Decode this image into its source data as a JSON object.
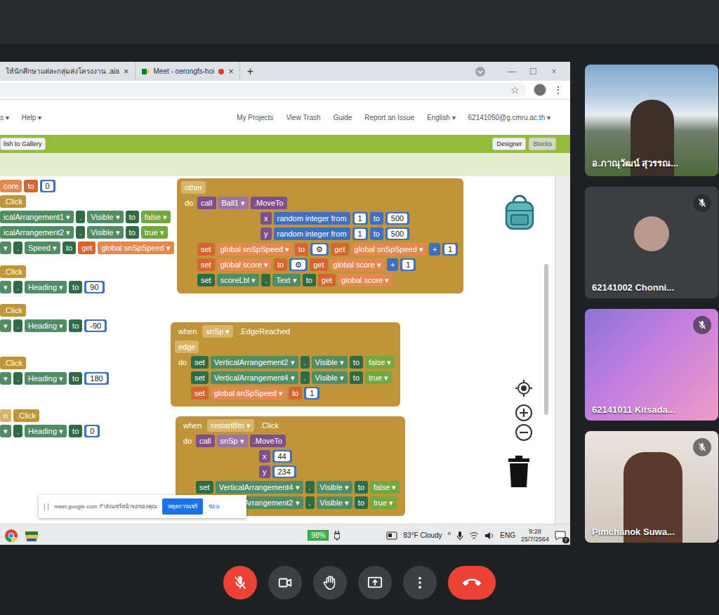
{
  "browser": {
    "tabs": [
      {
        "label": "ให้นักศึกษาแต่ละกลุ่มส่งโครงงาน .aia",
        "selected": false,
        "recording": false
      },
      {
        "label": "Meet - oerongfs-hoi",
        "selected": false,
        "recording": true
      }
    ],
    "tab_close": "×",
    "new_tab": "+",
    "window_controls": [
      "—",
      "☐",
      "×"
    ],
    "toolbar": {
      "star": "☆",
      "menu": "⋮"
    }
  },
  "appinventor": {
    "left_menu": [
      "s ▾",
      "Help ▾"
    ],
    "right_menu": [
      "My Projects",
      "View Trash",
      "Guide",
      "Report an Issue",
      "English ▾",
      "62141050@g.cmru.ac.th ▾"
    ],
    "gallery_button": "lish to Gallery",
    "view_buttons": [
      {
        "label": "Designer",
        "selected": false
      },
      {
        "label": "Blocks",
        "selected": true
      }
    ]
  },
  "workspace": {
    "groups": [
      {
        "kind": "cut",
        "rows": [
          {
            "kind": "statement",
            "segments": [
              {
                "kind": "global-field",
                "text": "core"
              },
              {
                "kind": "global",
                "text": "to"
              },
              {
                "kind": "number",
                "text": "0"
              }
            ]
          },
          {
            "kind": "head",
            "segments": [
              {
                "kind": "event",
                "text": ".Click"
              }
            ]
          },
          {
            "kind": "statement",
            "segments": [
              {
                "kind": "set-field",
                "text": "icalArrangement1 ▾"
              },
              {
                "kind": "set",
                "text": "."
              },
              {
                "kind": "set-field",
                "text": "Visible ▾"
              },
              {
                "kind": "set",
                "text": "to"
              },
              {
                "kind": "logic",
                "text": "false ▾"
              }
            ]
          },
          {
            "kind": "statement",
            "segments": [
              {
                "kind": "set-field",
                "text": "icalArrangement2 ▾"
              },
              {
                "kind": "set",
                "text": "."
              },
              {
                "kind": "set-field",
                "text": "Visible ▾"
              },
              {
                "kind": "set",
                "text": "to"
              },
              {
                "kind": "logic",
                "text": "true ▾"
              }
            ]
          },
          {
            "kind": "statement",
            "segments": [
              {
                "kind": "set-field",
                "text": "▾"
              },
              {
                "kind": "set",
                "text": "."
              },
              {
                "kind": "set-field",
                "text": "Speed ▾"
              },
              {
                "kind": "set",
                "text": "to"
              },
              {
                "kind": "get",
                "text": "get"
              },
              {
                "kind": "get-field",
                "text": "global snSpSpeed ▾"
              }
            ]
          }
        ]
      },
      {
        "kind": "cut",
        "rows": [
          {
            "kind": "head",
            "segments": [
              {
                "kind": "event",
                "text": ".Click"
              }
            ]
          },
          {
            "kind": "statement",
            "segments": [
              {
                "kind": "set-field",
                "text": "▾"
              },
              {
                "kind": "set",
                "text": "."
              },
              {
                "kind": "set-field",
                "text": "Heading ▾"
              },
              {
                "kind": "set",
                "text": "to"
              },
              {
                "kind": "number",
                "text": "90"
              }
            ]
          }
        ]
      },
      {
        "kind": "cut",
        "rows": [
          {
            "kind": "head",
            "segments": [
              {
                "kind": "event",
                "text": ".Click"
              }
            ]
          },
          {
            "kind": "statement",
            "segments": [
              {
                "kind": "set-field",
                "text": "▾"
              },
              {
                "kind": "set",
                "text": "."
              },
              {
                "kind": "set-field",
                "text": "Heading ▾"
              },
              {
                "kind": "set",
                "text": "to"
              },
              {
                "kind": "number",
                "text": "-90"
              }
            ]
          }
        ]
      },
      {
        "kind": "cut",
        "rows": [
          {
            "kind": "head",
            "segments": [
              {
                "kind": "event",
                "text": ".Click"
              }
            ]
          },
          {
            "kind": "statement",
            "segments": [
              {
                "kind": "set-field",
                "text": "▾"
              },
              {
                "kind": "set",
                "text": "."
              },
              {
                "kind": "set-field",
                "text": "Heading ▾"
              },
              {
                "kind": "set",
                "text": "to"
              },
              {
                "kind": "number",
                "text": "180"
              }
            ]
          }
        ]
      },
      {
        "kind": "cut",
        "rows": [
          {
            "kind": "head",
            "segments": [
              {
                "kind": "event-field",
                "text": "n"
              },
              {
                "kind": "event",
                "text": ".Click"
              }
            ]
          },
          {
            "kind": "statement",
            "segments": [
              {
                "kind": "set-field",
                "text": "▾"
              },
              {
                "kind": "set",
                "text": "."
              },
              {
                "kind": "set-field",
                "text": "Heading ▾"
              },
              {
                "kind": "set",
                "text": "to"
              },
              {
                "kind": "number",
                "text": "0"
              }
            ]
          }
        ]
      },
      {
        "kind": "event",
        "rows": [
          {
            "kind": "head",
            "segments": [
              {
                "kind": "event-field",
                "text": "other"
              }
            ]
          },
          {
            "kind": "do",
            "segments": [
              {
                "kind": "event",
                "text": "do"
              },
              {
                "kind": "call",
                "text": "call"
              },
              {
                "kind": "call-field",
                "text": "Ball1 ▾"
              },
              {
                "kind": "call",
                "text": ".MoveTo"
              }
            ]
          },
          {
            "kind": "argument",
            "segments": [
              {
                "kind": "call",
                "text": "x"
              },
              {
                "kind": "math",
                "text": "random integer from"
              },
              {
                "kind": "number",
                "text": "1"
              },
              {
                "kind": "math",
                "text": "to"
              },
              {
                "kind": "number",
                "text": "500"
              }
            ]
          },
          {
            "kind": "argument",
            "segments": [
              {
                "kind": "call",
                "text": "y"
              },
              {
                "kind": "math",
                "text": "random integer from"
              },
              {
                "kind": "number",
                "text": "1"
              },
              {
                "kind": "math",
                "text": "to"
              },
              {
                "kind": "number",
                "text": "500"
              }
            ]
          },
          {
            "kind": "statement",
            "segments": [
              {
                "kind": "global",
                "text": "set"
              },
              {
                "kind": "global-field",
                "text": "global snSpSpeed ▾"
              },
              {
                "kind": "global",
                "text": "to"
              },
              {
                "kind": "gear",
                "text": "⚙"
              },
              {
                "kind": "get",
                "text": "get"
              },
              {
                "kind": "get-field",
                "text": "global snSpSpeed ▾"
              },
              {
                "kind": "math",
                "text": "+"
              },
              {
                "kind": "number",
                "text": "1"
              }
            ]
          },
          {
            "kind": "statement",
            "segments": [
              {
                "kind": "global",
                "text": "set"
              },
              {
                "kind": "global-field",
                "text": "global score ▾"
              },
              {
                "kind": "global",
                "text": "to"
              },
              {
                "kind": "gear",
                "text": "⚙"
              },
              {
                "kind": "get",
                "text": "get"
              },
              {
                "kind": "get-field",
                "text": "global score ▾"
              },
              {
                "kind": "math",
                "text": "+"
              },
              {
                "kind": "number",
                "text": "1"
              }
            ]
          },
          {
            "kind": "statement",
            "segments": [
              {
                "kind": "set",
                "text": "set"
              },
              {
                "kind": "set-field",
                "text": "scoreLbl ▾"
              },
              {
                "kind": "set",
                "text": "."
              },
              {
                "kind": "set-field",
                "text": "Text ▾"
              },
              {
                "kind": "set",
                "text": "to"
              },
              {
                "kind": "get",
                "text": "get"
              },
              {
                "kind": "get-field",
                "text": "global score ▾"
              }
            ]
          }
        ]
      },
      {
        "kind": "event",
        "rows": [
          {
            "kind": "head",
            "segments": [
              {
                "kind": "event",
                "text": "when"
              },
              {
                "kind": "event-field",
                "text": "snSp ▾"
              },
              {
                "kind": "event",
                "text": ".EdgeReached"
              }
            ]
          },
          {
            "kind": "head",
            "segments": [
              {
                "kind": "event-field",
                "text": "edge"
              }
            ]
          },
          {
            "kind": "do",
            "segments": [
              {
                "kind": "event",
                "text": "do"
              },
              {
                "kind": "set",
                "text": "set"
              },
              {
                "kind": "set-field",
                "text": "VerticalArrangement2 ▾"
              },
              {
                "kind": "set",
                "text": "."
              },
              {
                "kind": "set-field",
                "text": "Visible ▾"
              },
              {
                "kind": "set",
                "text": "to"
              },
              {
                "kind": "logic",
                "text": "false ▾"
              }
            ]
          },
          {
            "kind": "statement",
            "segments": [
              {
                "kind": "set",
                "text": "set"
              },
              {
                "kind": "set-field",
                "text": "VerticalArrangement4 ▾"
              },
              {
                "kind": "set",
                "text": "."
              },
              {
                "kind": "set-field",
                "text": "Visible ▾"
              },
              {
                "kind": "set",
                "text": "to"
              },
              {
                "kind": "logic",
                "text": "true ▾"
              }
            ]
          },
          {
            "kind": "statement",
            "segments": [
              {
                "kind": "global",
                "text": "set"
              },
              {
                "kind": "global-field",
                "text": "global snSpSpeed ▾"
              },
              {
                "kind": "global",
                "text": "to"
              },
              {
                "kind": "number",
                "text": "1"
              }
            ]
          }
        ]
      },
      {
        "kind": "event",
        "rows": [
          {
            "kind": "head",
            "segments": [
              {
                "kind": "event",
                "text": "when"
              },
              {
                "kind": "event-field",
                "text": "restartBtn ▾"
              },
              {
                "kind": "event",
                "text": ".Click"
              }
            ]
          },
          {
            "kind": "do",
            "segments": [
              {
                "kind": "event",
                "text": "do"
              },
              {
                "kind": "call",
                "text": "call"
              },
              {
                "kind": "call-field",
                "text": "snSp ▾"
              },
              {
                "kind": "call",
                "text": ".MoveTo"
              }
            ]
          },
          {
            "kind": "argument",
            "segments": [
              {
                "kind": "call",
                "text": "x"
              },
              {
                "kind": "number",
                "text": "44"
              }
            ]
          },
          {
            "kind": "argument",
            "segments": [
              {
                "kind": "call",
                "text": "y"
              },
              {
                "kind": "number",
                "text": "234"
              }
            ]
          },
          {
            "kind": "statement",
            "segments": [
              {
                "kind": "set",
                "text": "set"
              },
              {
                "kind": "set-field",
                "text": "VerticalArrangement4 ▾"
              },
              {
                "kind": "set",
                "text": "."
              },
              {
                "kind": "set-field",
                "text": "Visible ▾"
              },
              {
                "kind": "set",
                "text": "to"
              },
              {
                "kind": "logic",
                "text": "false ▾"
              }
            ]
          },
          {
            "kind": "statement",
            "segments": [
              {
                "kind": "set",
                "text": "set"
              },
              {
                "kind": "set-field",
                "text": "VerticalArrangement2 ▾"
              },
              {
                "kind": "set",
                "text": "."
              },
              {
                "kind": "set-field",
                "text": "Visible ▾"
              },
              {
                "kind": "set",
                "text": "to"
              },
              {
                "kind": "logic",
                "text": "true ▾"
              }
            ]
          }
        ]
      }
    ]
  },
  "notification": {
    "text": "meet.google.com กำลังแชร์หน้าจอของคุณ",
    "stop": "หยุดการแชร์",
    "hide": "ซ่อน"
  },
  "taskbar": {
    "battery": "98%",
    "weather": "83°F Cloudy",
    "tray_arrow": "^",
    "language": "ENG",
    "time": "9:28",
    "date": "25/7/2564",
    "notifications": "7"
  },
  "participants": [
    {
      "name": "อ.ภาณุวัฒน์ สุวรรณ...",
      "muted": false,
      "kind": "landscape"
    },
    {
      "name": "62141002 Chonni...",
      "muted": true,
      "kind": "avatar"
    },
    {
      "name": "62141011 Kitsada...",
      "muted": true,
      "kind": "illustration"
    },
    {
      "name": "Pimchanok Suwa...",
      "muted": true,
      "kind": "portrait"
    }
  ],
  "controls": [
    {
      "kind": "mic",
      "on": false
    },
    {
      "kind": "camera",
      "on": true
    },
    {
      "kind": "hand",
      "on": false
    },
    {
      "kind": "present",
      "on": false
    },
    {
      "kind": "more",
      "on": false
    },
    {
      "kind": "hangup",
      "on": false
    }
  ]
}
